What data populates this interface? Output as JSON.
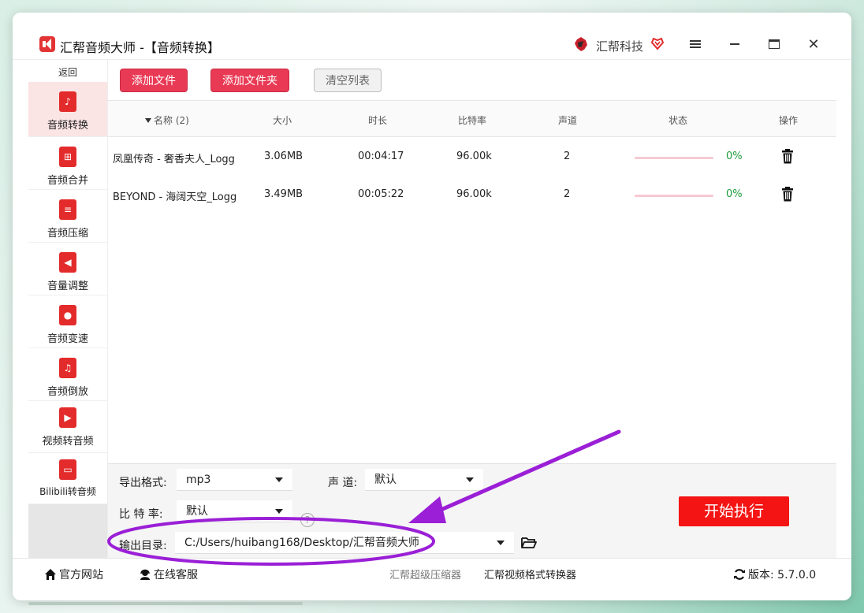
{
  "window": {
    "title": "汇帮音频大师  -【音频转换】",
    "brand": "汇帮科技"
  },
  "sidebar": {
    "back_label": "返回",
    "items": [
      {
        "label": "音频转换",
        "icon": "audio-convert-icon",
        "glyph": "♪"
      },
      {
        "label": "音频合并",
        "icon": "audio-merge-icon",
        "glyph": "⊞"
      },
      {
        "label": "音频压缩",
        "icon": "audio-compress-icon",
        "glyph": "≡"
      },
      {
        "label": "音量调整",
        "icon": "volume-icon",
        "glyph": "◀"
      },
      {
        "label": "音频变速",
        "icon": "microphone-icon",
        "glyph": "●"
      },
      {
        "label": "音频倒放",
        "icon": "music-note-icon",
        "glyph": "♫"
      },
      {
        "label": "视频转音频",
        "icon": "film-icon",
        "glyph": "▶"
      },
      {
        "label": "Bilibili转音频",
        "icon": "tv-icon",
        "glyph": "▭"
      }
    ]
  },
  "toolbar": {
    "add_file": "添加文件",
    "add_folder": "添加文件夹",
    "clear_list": "清空列表"
  },
  "table": {
    "headers": {
      "name": "名称",
      "count": "(2)",
      "size": "大小",
      "duration": "时长",
      "bitrate": "比特率",
      "channels": "声道",
      "status": "状态",
      "action": "操作"
    },
    "rows": [
      {
        "name": "凤凰传奇 - 奢香夫人_Logg",
        "size": "3.06MB",
        "duration": "00:04:17",
        "bitrate": "96.00k",
        "channels": "2",
        "progress": 0,
        "progress_label": "0%"
      },
      {
        "name": "BEYOND - 海阔天空_Logg",
        "size": "3.49MB",
        "duration": "00:05:22",
        "bitrate": "96.00k",
        "channels": "2",
        "progress": 0,
        "progress_label": "0%"
      }
    ]
  },
  "settings": {
    "format_label": "导出格式:",
    "format_value": "mp3",
    "channel_label": "声 道:",
    "channel_value": "默认",
    "bitrate_label": "比 特 率:",
    "bitrate_value": "默认",
    "help_glyph": "?",
    "output_label": "输出目录:",
    "output_value": "C:/Users/huibang168/Desktop/汇帮音频大师",
    "start_button": "开始执行"
  },
  "footer": {
    "website": "官方网站",
    "support": "在线客服",
    "compressor": "汇帮超级压缩器",
    "video_converter": "汇帮视频格式转换器",
    "version_label": "版本:",
    "version": "5.7.0.0"
  },
  "colors": {
    "accent_red": "#e93a55",
    "start_red": "#f41414",
    "annotation_purple": "#9a1fd6",
    "progress_green": "#1d9a3b"
  }
}
